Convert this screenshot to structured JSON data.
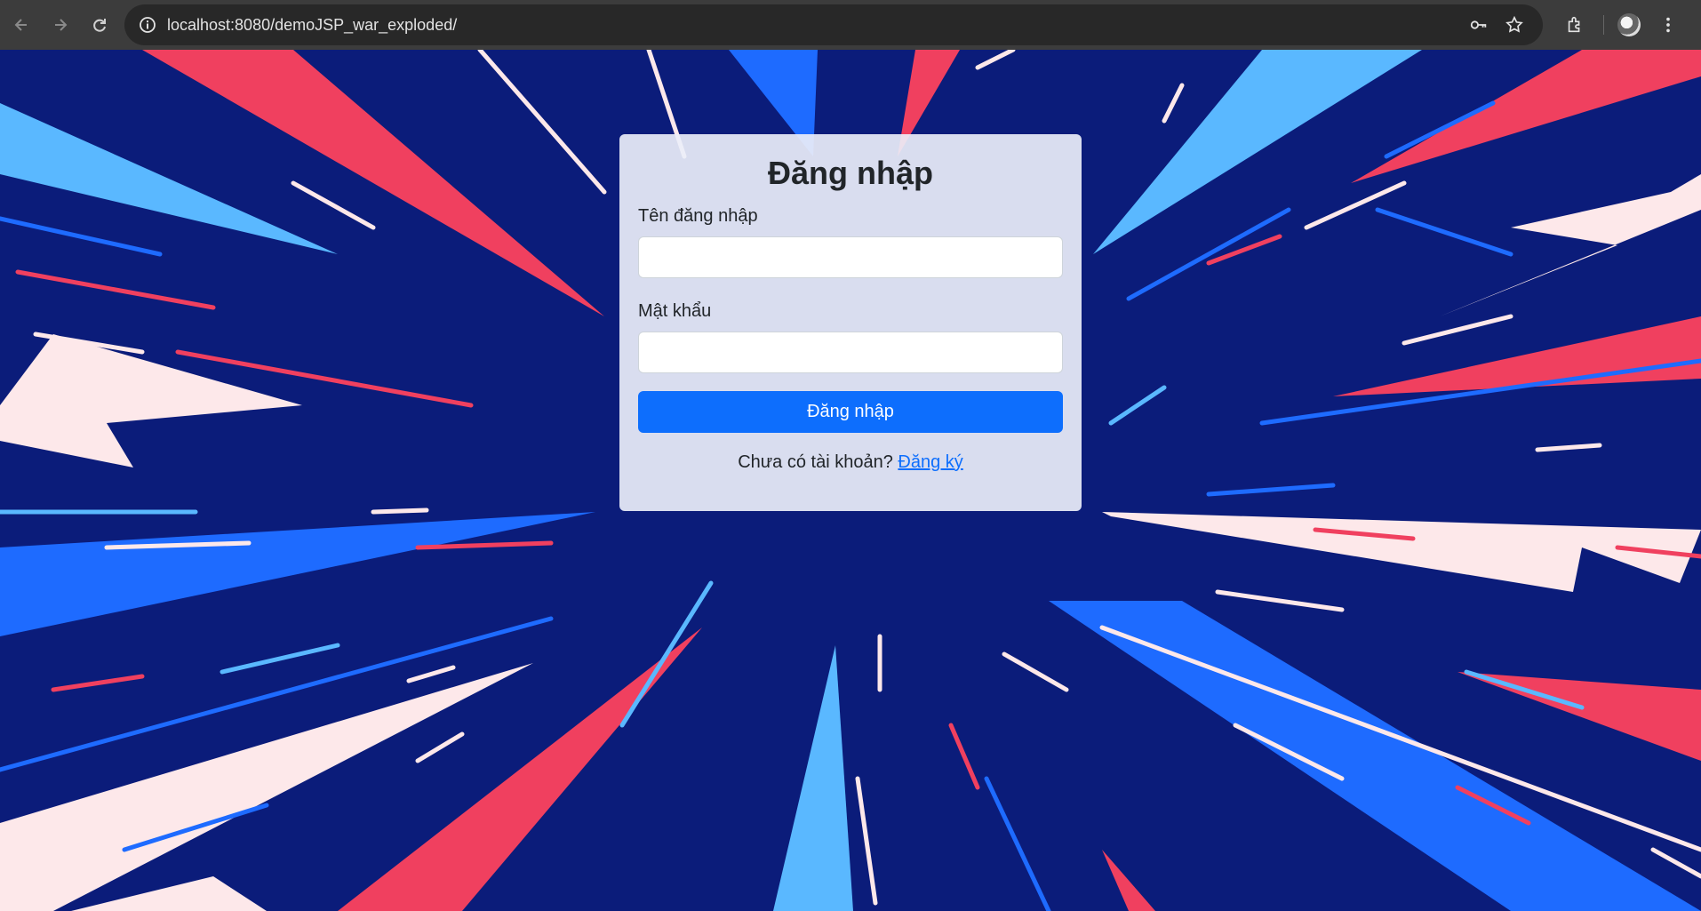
{
  "browser": {
    "url": "localhost:8080/demoJSP_war_exploded/",
    "icons": [
      "back-icon",
      "forward-icon",
      "reload-icon",
      "site-info-icon",
      "password-key-icon",
      "bookmark-star-icon",
      "extensions-icon",
      "profile-avatar-icon",
      "menu-kebab-icon"
    ]
  },
  "login": {
    "title": "Đăng nhập",
    "username_label": "Tên đăng nhập",
    "username_value": "",
    "password_label": "Mật khẩu",
    "password_value": "",
    "submit_label": "Đăng nhập",
    "no_account_text": "Chưa có tài khoản?",
    "register_link": "Đăng ký"
  },
  "colors": {
    "accent": "#0d6efd",
    "background_navy": "#0b1c7a",
    "burst_red": "#f0405f",
    "burst_blue": "#1e6bff",
    "burst_light_blue": "#5ab8ff",
    "burst_white": "#fde8ea"
  }
}
